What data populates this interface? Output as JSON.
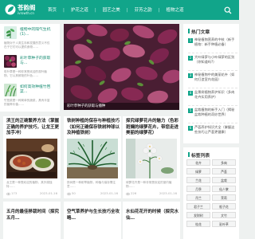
{
  "site": {
    "name": "苍韵阁",
    "domain": "ivrowth.cn",
    "colors": {
      "brand": "#11a58a",
      "link": "#1c8f76",
      "background": "#eef1f0"
    }
  },
  "nav": {
    "items": [
      "首页",
      "护花之道",
      "园艺之美",
      "芬芳之韵",
      "植物之道"
    ]
  },
  "side_list": [
    {
      "title": "植物中的隔气生机(1)…",
      "desc": "植物对于人类生存和发展的意义不仅在于它们可以提供食物……"
    },
    {
      "title": "彩叶草种子的获取与…",
      "desc": "彩叶草是一种非常受欢迎的观叶植物，它以其鲜艳的叶色……"
    },
    {
      "title": "如何高效种植竹笆菜…",
      "desc": "竹笆菜是一种简单的蔬菜，具有丰富的营养价值……"
    }
  ],
  "hero": {
    "caption": "彩叶草种子的获取与播种"
  },
  "right_panel": {
    "title": "热门文章",
    "items": [
      "神秘植物营养的中枝（新手植物：新手种植必备）",
      "大叶绿萝与小叶绿萝的区别（你知道吗?）",
      "神秘植物中的美丽花卉（如何打造室内花园）",
      "盆景树植物养护知识（多肉花卉实用养护）",
      "盆栽植物的新手入门（揭秘盆栽种植的奇妙世界）",
      "芦荟养护知识大全（掌握这些技巧让芦荟更健康）"
    ]
  },
  "tags_panel": {
    "title": "标签列表",
    "tags": [
      "花卉",
      "多肉",
      "绿萝",
      "芦荟",
      "兰花",
      "盆栽",
      "月季",
      "仙人掌",
      "吊兰",
      "茉莉",
      "君子兰",
      "栀子花",
      "发财树",
      "文竹",
      "桂花",
      "彩叶草"
    ]
  },
  "posts": [
    {
      "title": "滨王的正确繁养方法（掌握正确的养护技巧，让龙王更加手冲）",
      "summary": "龙王是一种受欢迎的植物，其外观独特……",
      "views": "173",
      "date": "2023-01-16"
    },
    {
      "title": "铁树种植的保存与种植技巧（如何正确保存铁树种球以及种植铁树）",
      "summary": "铁树是一种耐旱植物，种植与保存需注意……",
      "views": "50",
      "date": "2023-01-16"
    },
    {
      "title": "探究绿萝花卉的魅力（色彩斑斓的绿萝花卉，带您走进美丽的绿萝花）",
      "summary": "绿萝花卉是一种非常受欢迎的室内植物……",
      "views": "226",
      "date": "2023-01-16"
    }
  ],
  "more_posts": [
    {
      "title": "五月的最佳移栽时间（探究五月…"
    },
    {
      "title": "空气草养护与生长技巧全攻略…"
    },
    {
      "title": "水仙花花开的时候（探究水仙…"
    }
  ]
}
